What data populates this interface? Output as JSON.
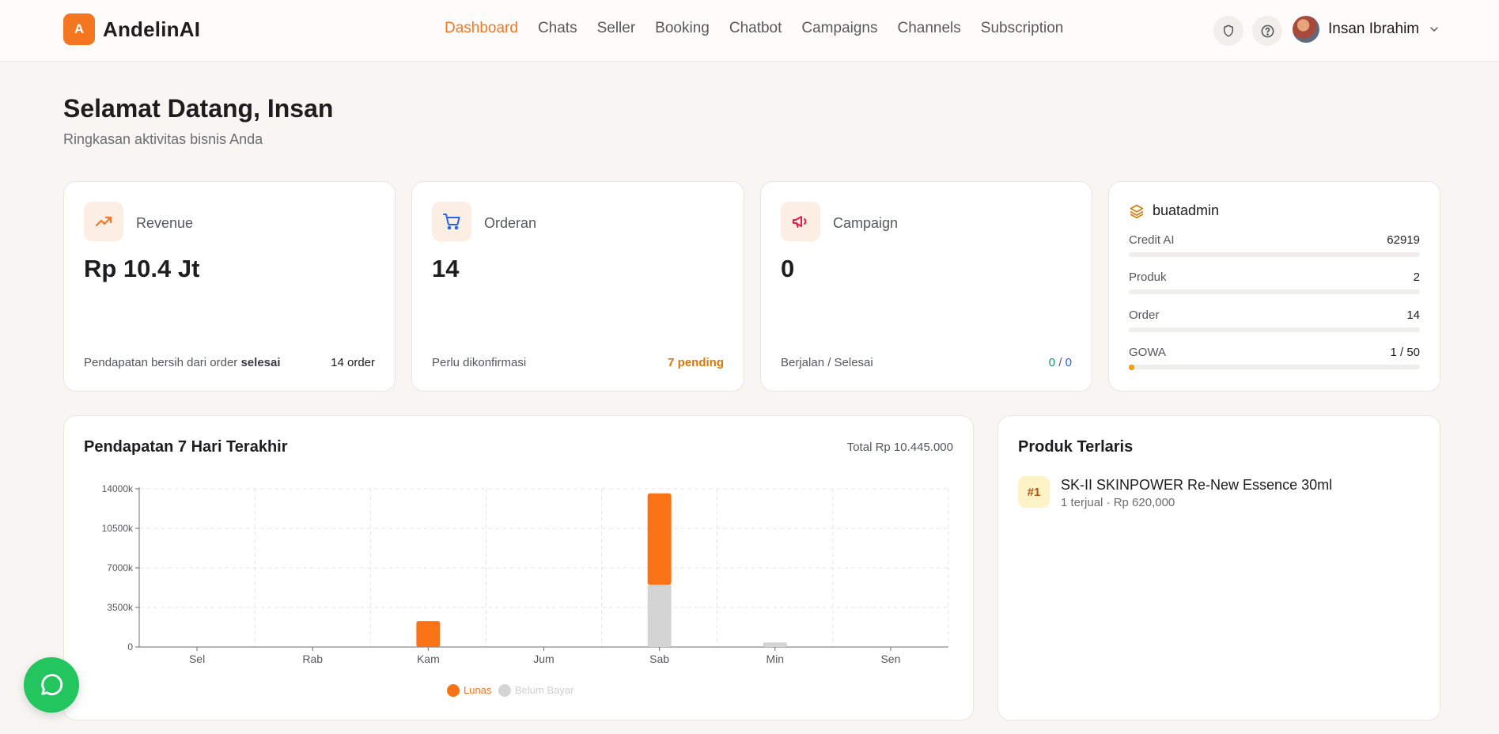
{
  "app": {
    "logo_letter": "A",
    "name": "AndelinAI"
  },
  "nav": [
    {
      "label": "Dashboard",
      "active": true
    },
    {
      "label": "Chats"
    },
    {
      "label": "Seller"
    },
    {
      "label": "Booking"
    },
    {
      "label": "Chatbot"
    },
    {
      "label": "Campaigns"
    },
    {
      "label": "Channels"
    },
    {
      "label": "Subscription"
    }
  ],
  "header": {
    "user_name": "Insan Ibrahim",
    "icons": [
      "shield-icon",
      "help-icon",
      "chevron-down-icon"
    ]
  },
  "greeting": {
    "title": "Selamat Datang, Insan",
    "subtitle": "Ringkasan aktivitas bisnis Anda"
  },
  "stats": {
    "revenue": {
      "label": "Revenue",
      "value": "Rp 10.4 Jt",
      "foot_prefix": "Pendapatan bersih dari order",
      "foot_bold": "selesai",
      "foot_right": "14 order",
      "icon": "trending-up-icon",
      "color": "#f57620"
    },
    "orders": {
      "label": "Orderan",
      "value": "14",
      "foot_left": "Perlu dikonfirmasi",
      "foot_right": "7 pending",
      "icon": "cart-icon",
      "color": "#2563eb",
      "accent": "#d97706"
    },
    "campaign": {
      "label": "Campaign",
      "value": "0",
      "foot_left": "Berjalan / Selesai",
      "running": "0",
      "separator": "/",
      "done": "0",
      "icon": "megaphone-icon",
      "color": "#e11d48",
      "running_color": "#059669",
      "done_color": "#2563eb"
    }
  },
  "quota": {
    "title": "buatadmin",
    "icon": "layers-icon",
    "rows": [
      {
        "label": "Credit AI",
        "value": "62919",
        "fill": 0
      },
      {
        "label": "Produk",
        "value": "2",
        "fill": 0
      },
      {
        "label": "Order",
        "value": "14",
        "fill": 0
      },
      {
        "label": "GOWA",
        "value": "1 / 50",
        "fill": 0.02
      }
    ]
  },
  "revenue_panel": {
    "title": "Pendapatan 7 Hari Terakhir",
    "total": "Total Rp 10.445.000"
  },
  "chart_data": {
    "type": "bar",
    "stacked": true,
    "categories": [
      "Sel",
      "Rab",
      "Kam",
      "Jum",
      "Sab",
      "Min",
      "Sen"
    ],
    "series": [
      {
        "name": "Lunas",
        "color": "#f97316",
        "values": [
          0,
          0,
          2300,
          0,
          8100,
          0,
          0
        ]
      },
      {
        "name": "Belum Bayar",
        "color": "#d4d4d4",
        "values": [
          0,
          0,
          0,
          0,
          5500,
          400,
          0
        ]
      }
    ],
    "y_ticks": [
      "0",
      "3500k",
      "7000k",
      "10500k",
      "14000k"
    ],
    "ylim": [
      0,
      14000
    ],
    "grid": true,
    "legend": "bottom-center"
  },
  "top_products": {
    "title": "Produk Terlaris",
    "items": [
      {
        "rank": "#1",
        "name": "SK-II SKINPOWER Re-New Essence 30ml",
        "meta": "1 terjual · Rp 620,000"
      }
    ]
  }
}
